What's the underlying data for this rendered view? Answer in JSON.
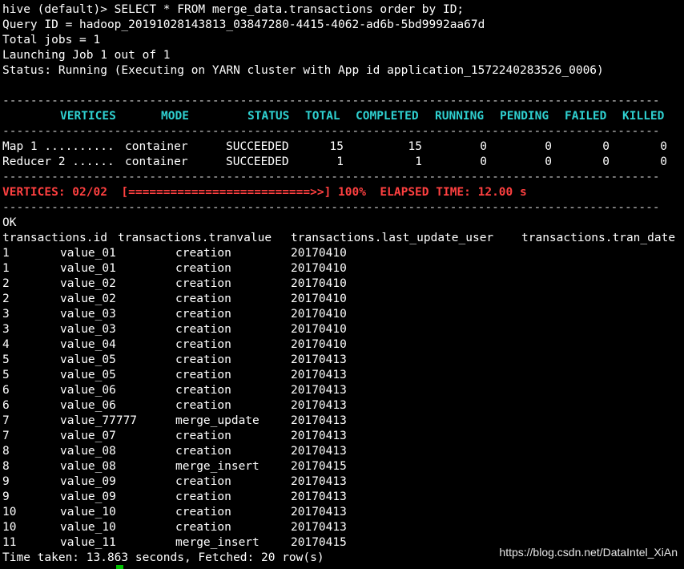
{
  "colors": {
    "background": "#000000",
    "text": "#ffffff",
    "header_cyan": "#2fd0d0",
    "status_red": "#ff4040",
    "cursor_green": "#00c000"
  },
  "preamble": [
    "hive (default)> SELECT * FROM merge_data.transactions order by ID;",
    "Query ID = hadoop_20191028143813_03847280-4415-4062-ad6b-5bd9992aa67d",
    "Total jobs = 1",
    "Launching Job 1 out of 1",
    "Status: Running (Executing on YARN cluster with App id application_1572240283526_0006)"
  ],
  "separator": "----------------------------------------------------------------------------------------------",
  "vertex_table": {
    "headers": [
      "VERTICES",
      "MODE",
      "STATUS",
      "TOTAL",
      "COMPLETED",
      "RUNNING",
      "PENDING",
      "FAILED",
      "KILLED"
    ],
    "rows": [
      [
        "Map 1 ..........",
        "container",
        "SUCCEEDED",
        "15",
        "15",
        "0",
        "0",
        "0",
        "0"
      ],
      [
        "Reducer 2 ......",
        "container",
        "SUCCEEDED",
        "1",
        "1",
        "0",
        "0",
        "0",
        "0"
      ]
    ]
  },
  "progress_line": "VERTICES: 02/02  [==========================>>] 100%  ELAPSED TIME: 12.00 s",
  "ok_text": "OK",
  "result_headers": [
    "transactions.id",
    "transactions.tranvalue",
    "transactions.last_update_user",
    "transactions.tran_date"
  ],
  "result_rows": [
    [
      "1",
      "value_01",
      "creation",
      "20170410"
    ],
    [
      "1",
      "value_01",
      "creation",
      "20170410"
    ],
    [
      "2",
      "value_02",
      "creation",
      "20170410"
    ],
    [
      "2",
      "value_02",
      "creation",
      "20170410"
    ],
    [
      "3",
      "value_03",
      "creation",
      "20170410"
    ],
    [
      "3",
      "value_03",
      "creation",
      "20170410"
    ],
    [
      "4",
      "value_04",
      "creation",
      "20170410"
    ],
    [
      "5",
      "value_05",
      "creation",
      "20170413"
    ],
    [
      "5",
      "value_05",
      "creation",
      "20170413"
    ],
    [
      "6",
      "value_06",
      "creation",
      "20170413"
    ],
    [
      "6",
      "value_06",
      "creation",
      "20170413"
    ],
    [
      "7",
      "value_77777",
      "merge_update",
      "20170413"
    ],
    [
      "7",
      "value_07",
      "creation",
      "20170413"
    ],
    [
      "8",
      "value_08",
      "creation",
      "20170413"
    ],
    [
      "8",
      "value_08",
      "merge_insert",
      "20170415"
    ],
    [
      "9",
      "value_09",
      "creation",
      "20170413"
    ],
    [
      "9",
      "value_09",
      "creation",
      "20170413"
    ],
    [
      "10",
      "value_10",
      "creation",
      "20170413"
    ],
    [
      "10",
      "value_10",
      "creation",
      "20170413"
    ],
    [
      "11",
      "value_11",
      "merge_insert",
      "20170415"
    ]
  ],
  "footer": "Time taken: 13.863 seconds, Fetched: 20 row(s)",
  "watermark": "https://blog.csdn.net/DataIntel_XiAn"
}
